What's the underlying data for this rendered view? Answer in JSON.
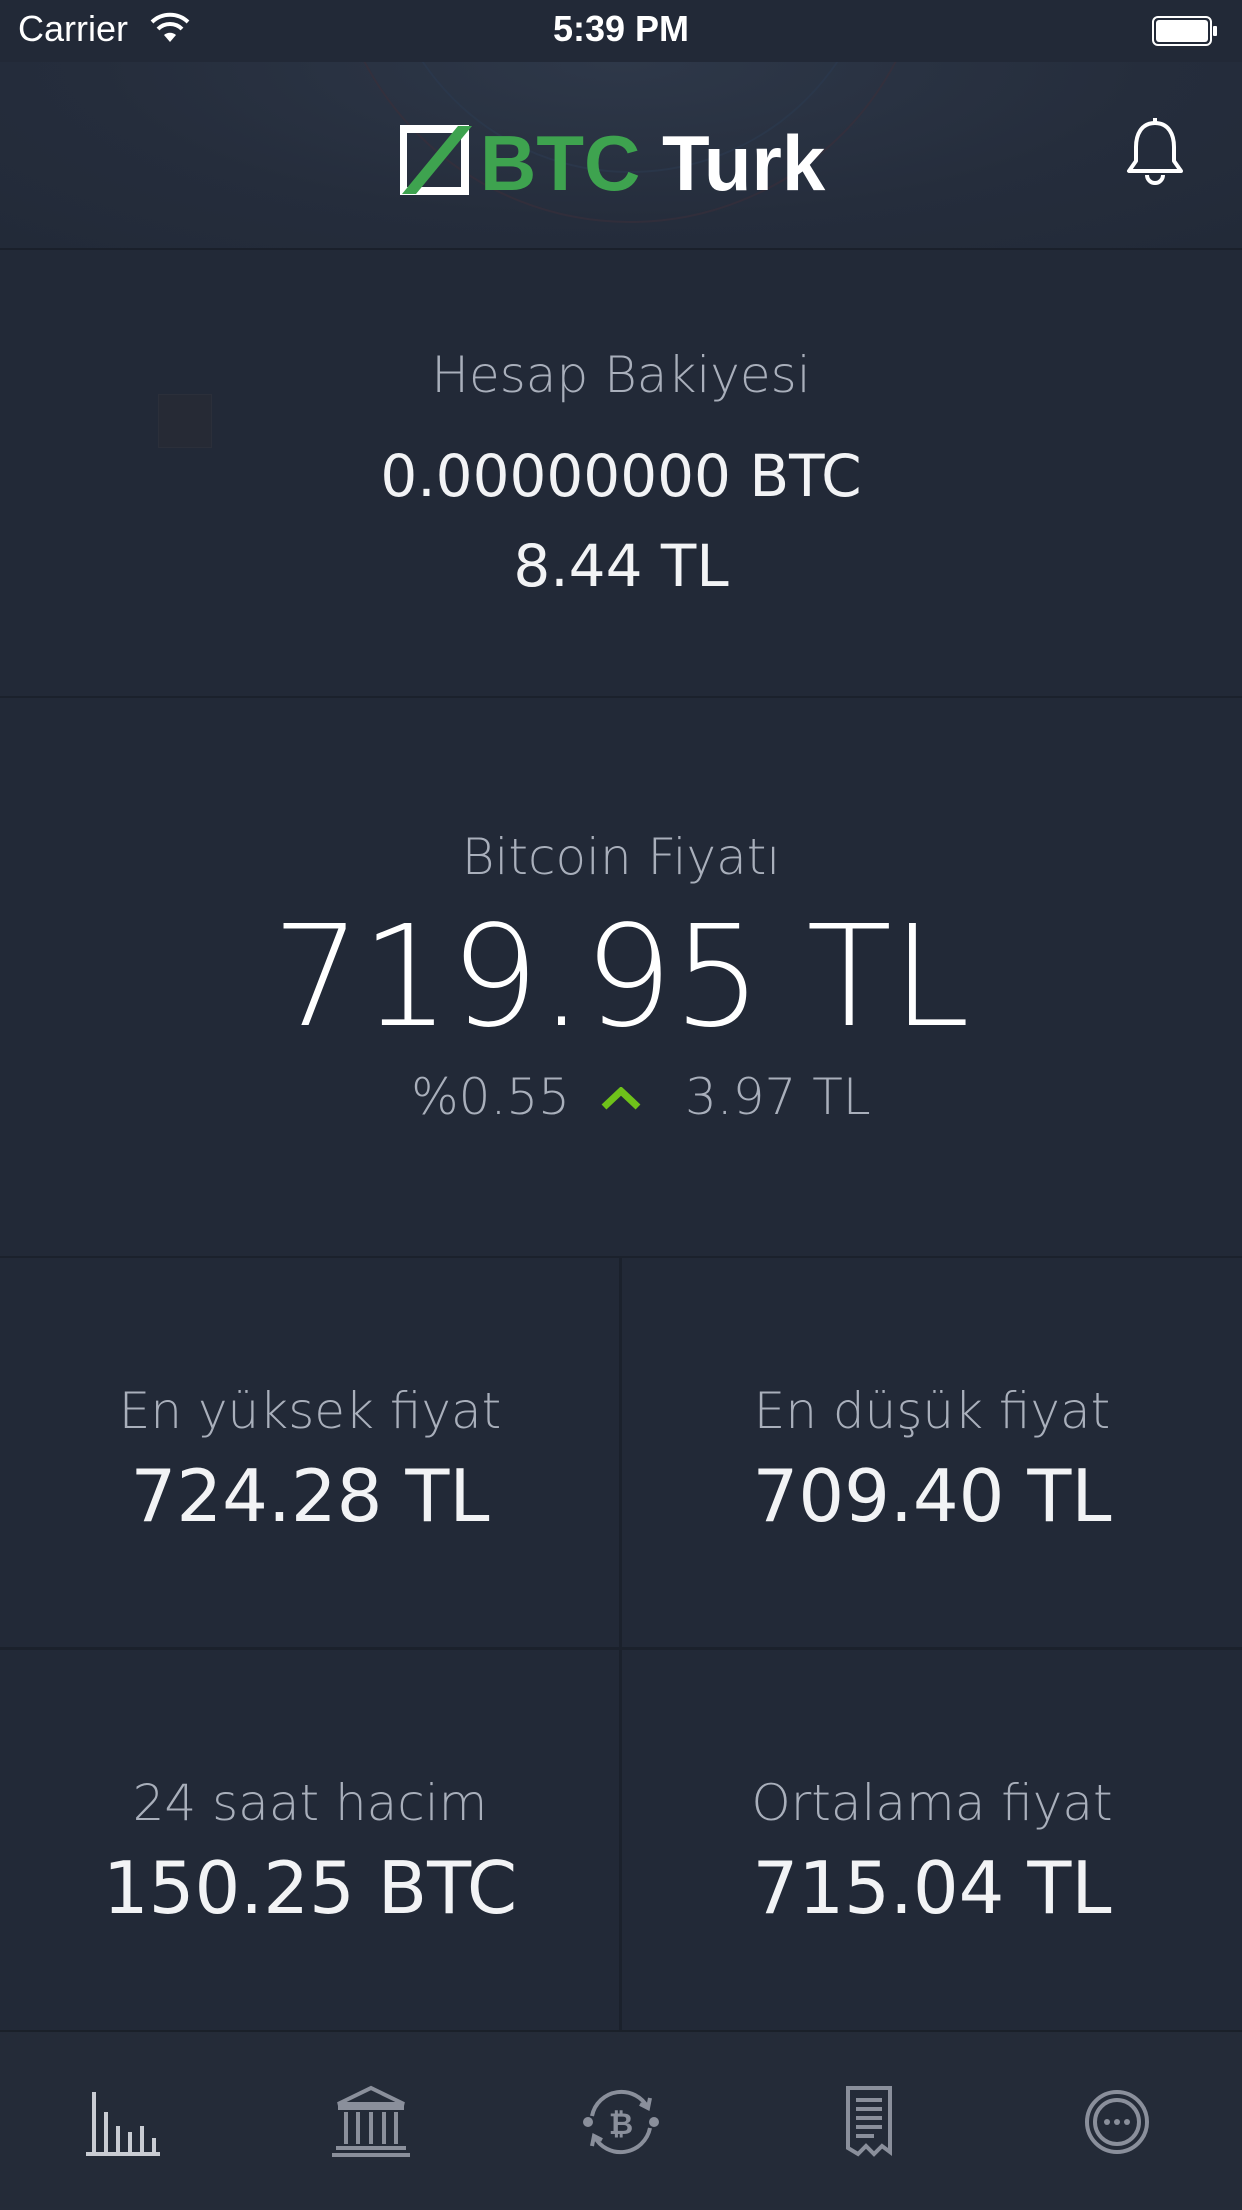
{
  "status_bar": {
    "carrier": "Carrier",
    "time": "5:39 PM"
  },
  "header": {
    "logo_text_btc": "BTC",
    "logo_text_turk": "Turk",
    "brand_green": "#3ea34f"
  },
  "balance": {
    "label": "Hesap Bakiyesi",
    "btc": "0.00000000 BTC",
    "tl": "8.44 TL"
  },
  "price": {
    "label": "Bitcoin Fiyatı",
    "value": "719.95 TL",
    "percent": "%0.55",
    "change": "3.97 TL",
    "trend": "up",
    "trend_color": "#6fc21a"
  },
  "stats": [
    {
      "label": "En yüksek fiyat",
      "value": "724.28 TL"
    },
    {
      "label": "En düşük fiyat",
      "value": "709.40 TL"
    },
    {
      "label": "24 saat hacim",
      "value": "150.25 BTC"
    },
    {
      "label": "Ortalama fiyat",
      "value": "715.04 TL"
    }
  ],
  "tabbar": {
    "items": [
      {
        "icon": "chart-bars-icon"
      },
      {
        "icon": "bank-icon"
      },
      {
        "icon": "bitcoin-exchange-icon"
      },
      {
        "icon": "receipt-icon"
      },
      {
        "icon": "more-icon"
      }
    ]
  }
}
